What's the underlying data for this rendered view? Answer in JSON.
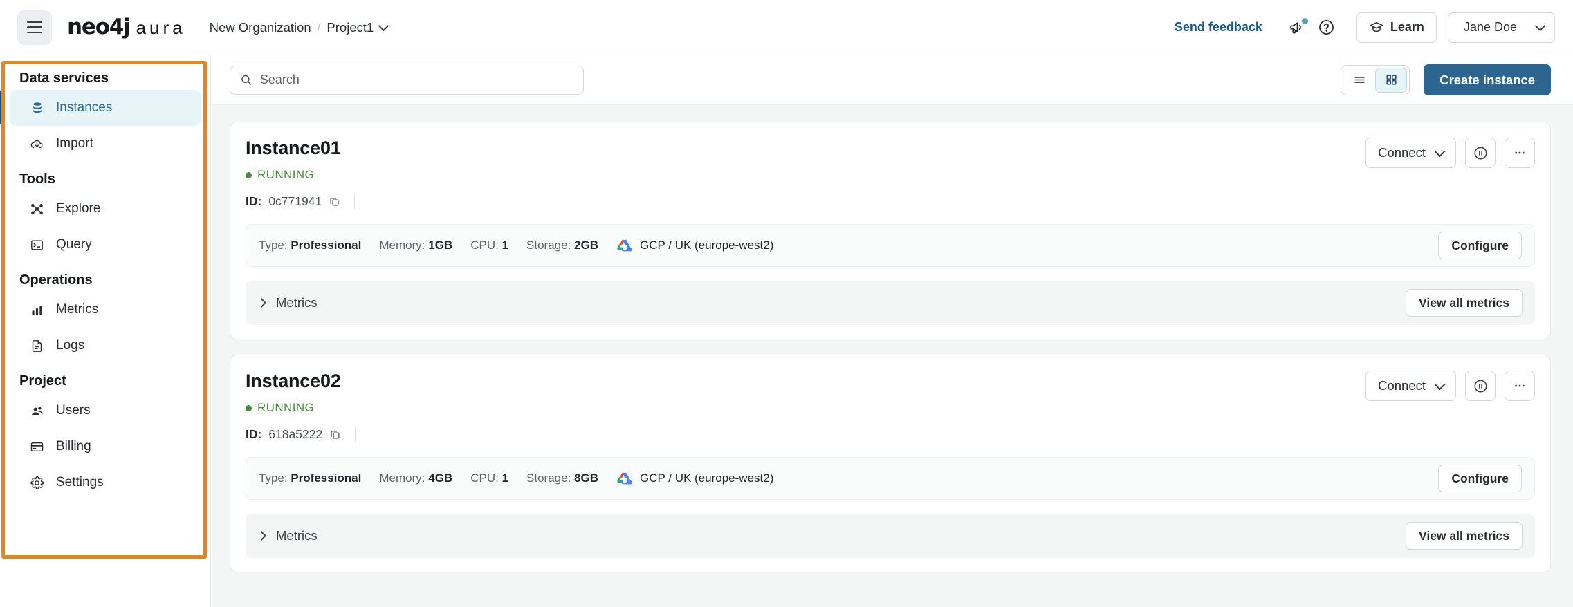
{
  "topbar": {
    "menu_icon": "hamburger-icon",
    "brand_primary": "neo4j",
    "brand_secondary": "aura",
    "breadcrumb": {
      "organization": "New Organization",
      "separator": "/",
      "project": "Project1",
      "chevron_icon": "chevron-down-icon"
    },
    "send_feedback": "Send feedback",
    "announcement_icon": "megaphone-icon",
    "help_icon": "question-circle-icon",
    "learn_label": "Learn",
    "learn_icon": "graduation-cap-icon",
    "user_name": "Jane Doe",
    "user_chevron_icon": "chevron-down-icon"
  },
  "sidebar": {
    "sections": [
      {
        "title": "Data services",
        "items": [
          {
            "label": "Instances",
            "icon": "database-icon",
            "active": true
          },
          {
            "label": "Import",
            "icon": "cloud-download-icon",
            "active": false
          }
        ]
      },
      {
        "title": "Tools",
        "items": [
          {
            "label": "Explore",
            "icon": "graph-nodes-icon",
            "active": false
          },
          {
            "label": "Query",
            "icon": "terminal-icon",
            "active": false
          }
        ]
      },
      {
        "title": "Operations",
        "items": [
          {
            "label": "Metrics",
            "icon": "bar-chart-icon",
            "active": false
          },
          {
            "label": "Logs",
            "icon": "document-lines-icon",
            "active": false
          }
        ]
      },
      {
        "title": "Project",
        "items": [
          {
            "label": "Users",
            "icon": "users-icon",
            "active": false
          },
          {
            "label": "Billing",
            "icon": "credit-card-icon",
            "active": false
          },
          {
            "label": "Settings",
            "icon": "gear-icon",
            "active": false
          }
        ]
      }
    ],
    "highlight_color": "#e08623",
    "active_bg": "#e6f3f7",
    "active_text_color": "#2d6d96"
  },
  "toolbar": {
    "search_placeholder": "Search",
    "search_value": "",
    "search_icon": "search-icon",
    "view_list_icon": "list-view-icon",
    "view_grid_icon": "grid-view-icon",
    "view_active": "grid",
    "create_instance_label": "Create instance",
    "create_btn_color": "#2b6590"
  },
  "instances": [
    {
      "name": "Instance01",
      "status": "RUNNING",
      "status_color": "#4a8c3f",
      "id_label": "ID:",
      "id_value": "0c771941",
      "copy_icon": "copy-icon",
      "connect_label": "Connect",
      "connect_chevron_icon": "chevron-down-icon",
      "pause_icon": "pause-circle-icon",
      "more_icon": "ellipsis-icon",
      "specs": [
        {
          "label": "Type:",
          "value": "Professional"
        },
        {
          "label": "Memory:",
          "value": "1GB"
        },
        {
          "label": "CPU:",
          "value": "1"
        },
        {
          "label": "Storage:",
          "value": "2GB"
        }
      ],
      "cloud_icon": "google-cloud-icon",
      "cloud_region": "GCP / UK (europe-west2)",
      "configure_label": "Configure",
      "metrics_label": "Metrics",
      "metrics_chevron_icon": "chevron-right-icon",
      "view_all_metrics_label": "View all metrics"
    },
    {
      "name": "Instance02",
      "status": "RUNNING",
      "status_color": "#4a8c3f",
      "id_label": "ID:",
      "id_value": "618a5222",
      "copy_icon": "copy-icon",
      "connect_label": "Connect",
      "connect_chevron_icon": "chevron-down-icon",
      "pause_icon": "pause-circle-icon",
      "more_icon": "ellipsis-icon",
      "specs": [
        {
          "label": "Type:",
          "value": "Professional"
        },
        {
          "label": "Memory:",
          "value": "4GB"
        },
        {
          "label": "CPU:",
          "value": "1"
        },
        {
          "label": "Storage:",
          "value": "8GB"
        }
      ],
      "cloud_icon": "google-cloud-icon",
      "cloud_region": "GCP / UK (europe-west2)",
      "configure_label": "Configure",
      "metrics_label": "Metrics",
      "metrics_chevron_icon": "chevron-right-icon",
      "view_all_metrics_label": "View all metrics"
    }
  ]
}
